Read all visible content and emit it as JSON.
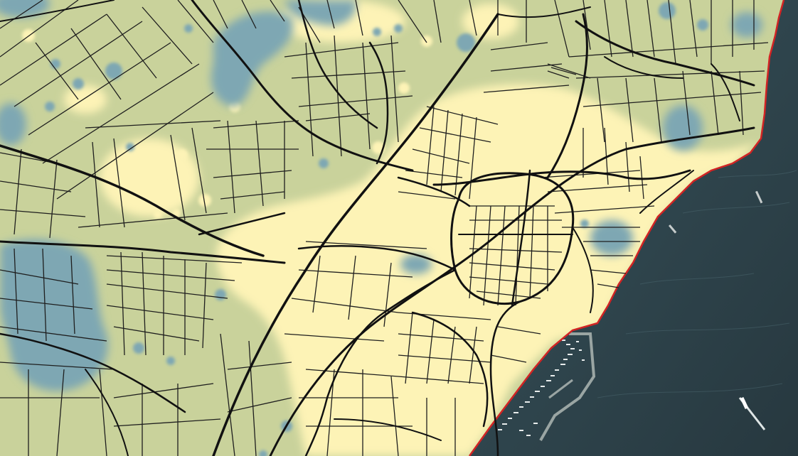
{
  "map": {
    "layers": [
      {
        "name": "land-base",
        "color": "#c9d29b"
      },
      {
        "name": "low-zone",
        "color": "#fdf3b6"
      },
      {
        "name": "high-zone",
        "color": "#7ea7b3"
      },
      {
        "name": "sea",
        "color": "#33474e"
      },
      {
        "name": "coastline",
        "color": "#d22424"
      },
      {
        "name": "roads",
        "color": "#111111"
      },
      {
        "name": "parcels",
        "color": "#222222"
      }
    ],
    "features": [
      "marina",
      "pier",
      "boat"
    ]
  }
}
